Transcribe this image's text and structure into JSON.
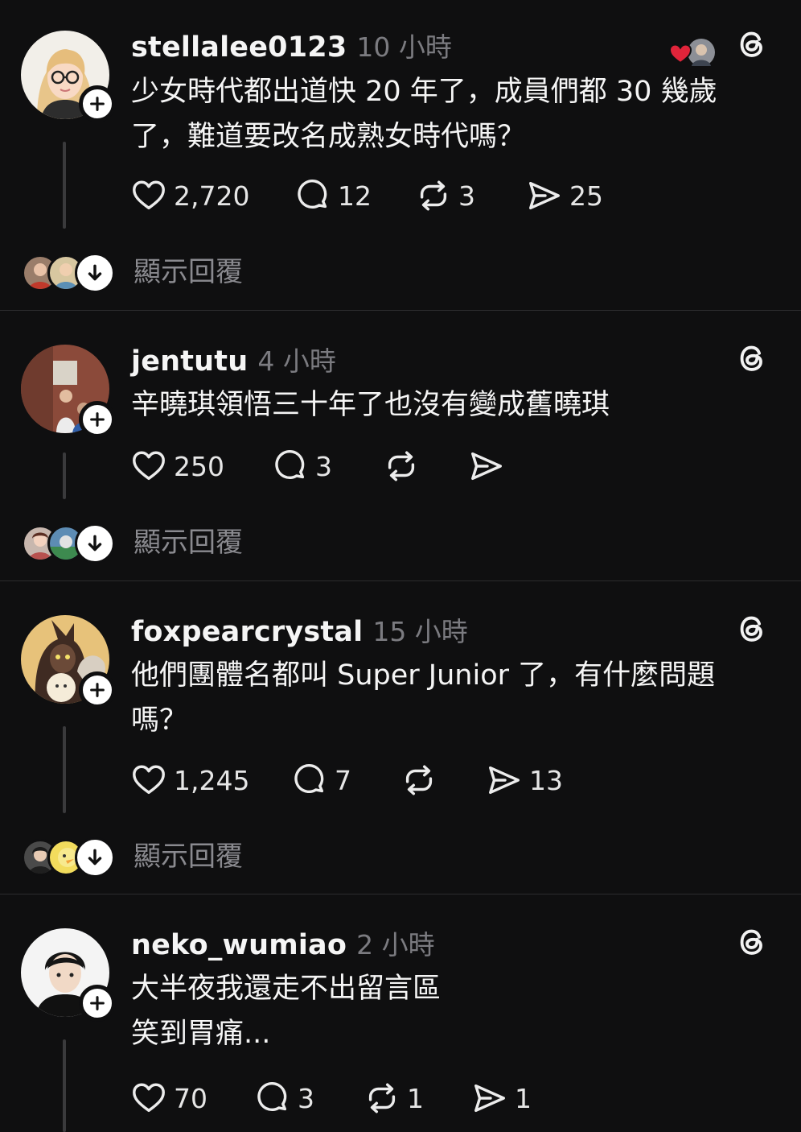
{
  "posts": [
    {
      "username": "stellalee0123",
      "time": "10 小時",
      "lines": [
        "少女時代都出道快 20 年了，成員們都 30 幾歲",
        "了，難道要改名成熟女時代嗎？"
      ],
      "likes": "2,720",
      "comments": "12",
      "reposts": "3",
      "shares": "25",
      "show_replies": "顯示回覆"
    },
    {
      "username": "jentutu",
      "time": "4 小時",
      "lines": [
        "辛曉琪領悟三十年了也沒有變成舊曉琪"
      ],
      "likes": "250",
      "comments": "3",
      "reposts": "",
      "shares": "",
      "show_replies": "顯示回覆"
    },
    {
      "username": "foxpearcrystal",
      "time": "15 小時",
      "lines": [
        "他們團體名都叫 Super Junior 了，有什麼問題",
        "嗎？"
      ],
      "likes": "1,245",
      "comments": "7",
      "reposts": "",
      "shares": "13",
      "show_replies": "顯示回覆"
    },
    {
      "username": "neko_wumiao",
      "time": "2 小時",
      "lines": [
        "大半夜我還走不出留言區",
        "笑到胃痛..."
      ],
      "likes": "70",
      "comments": "3",
      "reposts": "1",
      "shares": "1",
      "show_replies": ""
    }
  ],
  "icons": {
    "like": "heart-icon",
    "comment": "comment-bubble-icon",
    "repost": "repost-icon",
    "share": "send-icon",
    "follow": "plus-icon",
    "expand": "arrow-down-icon",
    "app": "threads-icon"
  },
  "colors": {
    "background": "#0f0f10",
    "text": "#f5f5f5",
    "muted": "#7b7b80",
    "liked_heart": "#e0243a"
  }
}
